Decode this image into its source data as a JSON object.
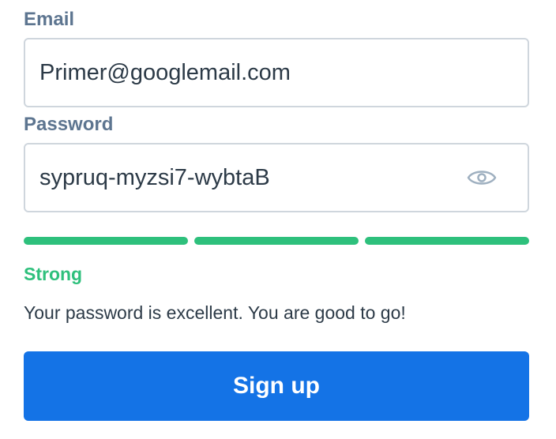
{
  "form": {
    "email": {
      "label": "Email",
      "value": "Primer@googlemail.com"
    },
    "password": {
      "label": "Password",
      "value": "sypruq-myzsi7-wybtaB",
      "toggle_icon": "eye-icon"
    },
    "strength": {
      "segments_filled": 3,
      "segments_total": 3,
      "color": "#2ec07c",
      "label": "Strong",
      "message": "Your password is excellent. You are good to go!"
    },
    "submit_label": "Sign up",
    "colors": {
      "accent": "#1473e6",
      "label": "#5d7590",
      "border": "#cfd6dd"
    }
  }
}
